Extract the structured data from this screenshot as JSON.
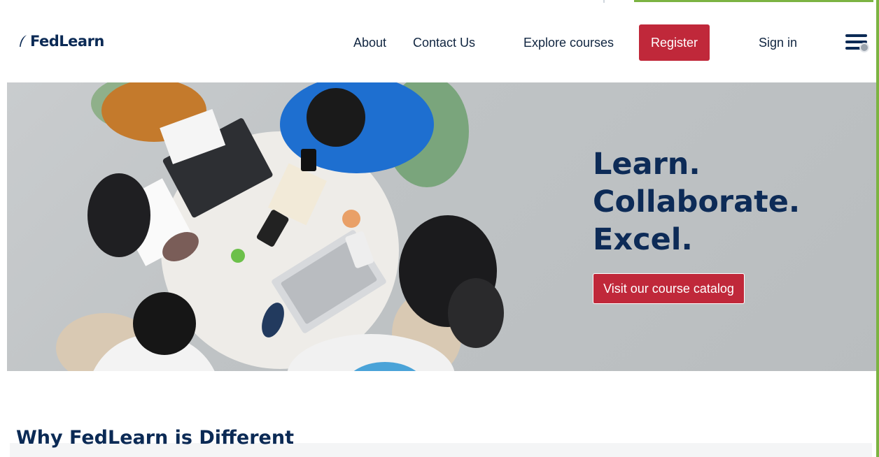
{
  "brand": {
    "name": "FedLearn",
    "color": "#0b2a55"
  },
  "nav": {
    "about": "About",
    "contact": "Contact Us",
    "explore": "Explore courses",
    "register": "Register",
    "signin": "Sign in",
    "menu_icon": "hamburger-menu-icon"
  },
  "hero": {
    "line1": "Learn.",
    "line2": "Collaborate.",
    "line3": "Excel.",
    "cta": "Visit our course catalog",
    "image": "students-collaborating-at-table-photo"
  },
  "section": {
    "title": "Why FedLearn is Different"
  },
  "colors": {
    "accent_red": "#c0283a",
    "navy": "#0b2a55",
    "accent_green": "#7cb342"
  }
}
